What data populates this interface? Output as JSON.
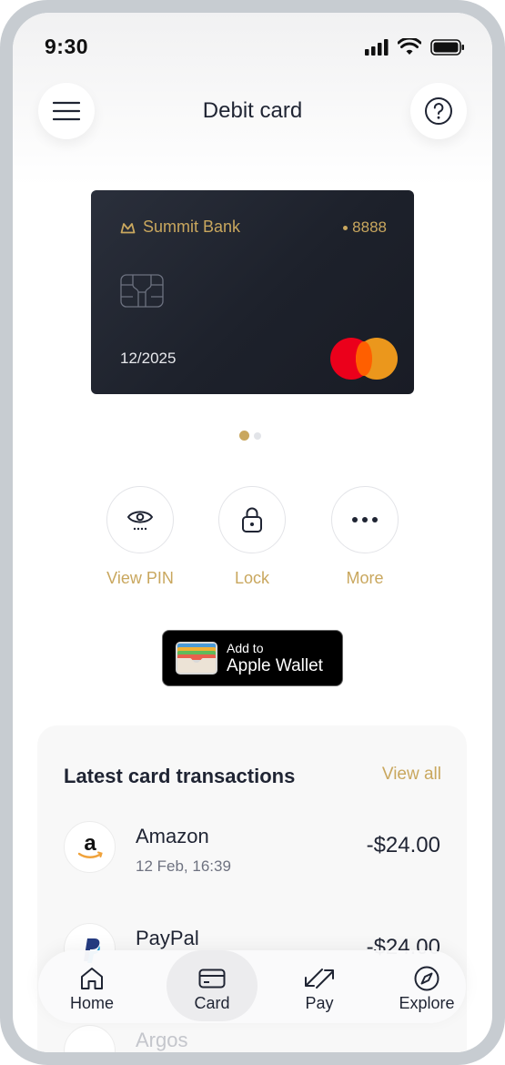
{
  "status": {
    "time": "9:30"
  },
  "header": {
    "title": "Debit card"
  },
  "card": {
    "bank_name": "Summit Bank",
    "last_digits": "8888",
    "expiry": "12/2025",
    "network": "mastercard"
  },
  "pager": {
    "current": 1,
    "total": 2
  },
  "actions": [
    {
      "label": "View PIN",
      "icon": "eye-icon"
    },
    {
      "label": "Lock",
      "icon": "lock-icon"
    },
    {
      "label": "More",
      "icon": "more-icon"
    }
  ],
  "wallet": {
    "line1": "Add to",
    "line2": "Apple Wallet"
  },
  "transactions": {
    "title": "Latest card transactions",
    "view_all": "View all",
    "items": [
      {
        "merchant": "Amazon",
        "date": "12 Feb, 16:39",
        "amount": "-$24.00",
        "icon": "amazon-logo"
      },
      {
        "merchant": "PayPal",
        "date": "",
        "amount": "-$24.00",
        "icon": "paypal-logo"
      },
      {
        "merchant": "Argos",
        "date": "",
        "amount": "",
        "icon": "argos-logo"
      }
    ]
  },
  "nav": [
    {
      "label": "Home",
      "icon": "home-icon",
      "selected": false
    },
    {
      "label": "Card",
      "icon": "card-icon",
      "selected": true
    },
    {
      "label": "Pay",
      "icon": "pay-icon",
      "selected": false
    },
    {
      "label": "Explore",
      "icon": "compass-icon",
      "selected": false
    }
  ],
  "colors": {
    "accent": "#c9a75e",
    "card": "#1d212b",
    "text": "#1f2433"
  }
}
